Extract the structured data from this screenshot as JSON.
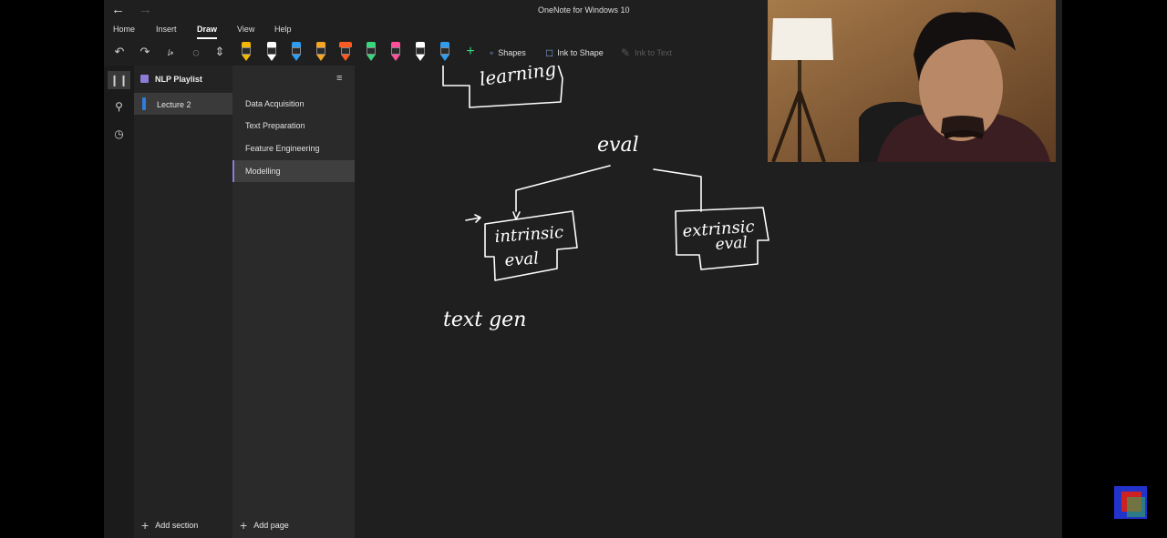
{
  "window": {
    "title": "OneNote for Windows 10"
  },
  "ribbon": {
    "tabs": [
      {
        "label": "Home"
      },
      {
        "label": "Insert"
      },
      {
        "label": "Draw"
      },
      {
        "label": "View"
      },
      {
        "label": "Help"
      }
    ],
    "active_tab": "Draw"
  },
  "toolbar": {
    "undo_icon": "undo-icon",
    "redo_icon": "redo-icon",
    "pens": [
      {
        "name": "pen-1",
        "color": "#f2b705"
      },
      {
        "name": "pen-2",
        "color": "#ffffff",
        "selected": true
      },
      {
        "name": "pen-3",
        "color": "#2f9cf0"
      },
      {
        "name": "pen-4",
        "color": "#f5a623"
      },
      {
        "name": "pen-5",
        "color": "#ff5a1f"
      },
      {
        "name": "pen-6",
        "color": "#38d67a"
      },
      {
        "name": "pen-7",
        "color": "#ff4f9a"
      },
      {
        "name": "pen-8",
        "color": "#ffffff"
      },
      {
        "name": "pen-9",
        "color": "#2f9cf0"
      }
    ],
    "shapes_label": "Shapes",
    "ink_to_shape_label": "Ink to Shape",
    "ink_to_text_label": "Ink to Text"
  },
  "notebook": {
    "name": "NLP Playlist",
    "sections": [
      {
        "label": "Lecture 2",
        "color": "#2f7be0",
        "active": true
      }
    ],
    "add_section_label": "Add section"
  },
  "pages": {
    "items": [
      {
        "label": "Data Acquisition"
      },
      {
        "label": "Text Preparation"
      },
      {
        "label": "Feature Engineering"
      },
      {
        "label": "Modelling",
        "active": true
      }
    ],
    "add_page_label": "Add page"
  },
  "canvas": {
    "handwriting": {
      "top_box": "learning",
      "root": "eval",
      "left_box_line1": "intrinsic",
      "left_box_line2": "eval",
      "right_box_line1": "extrinsic",
      "right_box_line2": "eval",
      "note": "text gen"
    }
  },
  "colors": {
    "accent": "#8f7ad6",
    "section_tab": "#2f7be0",
    "ink": "#ffffff"
  }
}
